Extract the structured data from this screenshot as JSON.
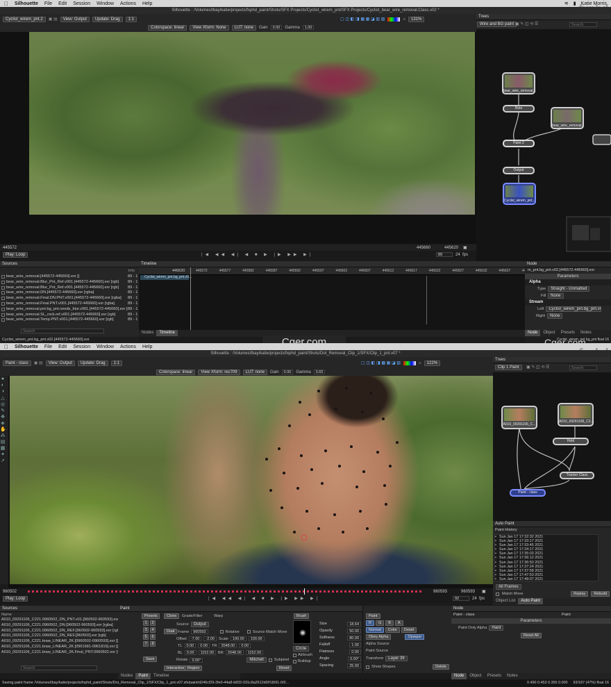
{
  "top": {
    "menubar": {
      "app": "Silhouette",
      "items": [
        "File",
        "Edit",
        "Session",
        "Window",
        "Actions",
        "Help"
      ],
      "window_title": "Silhouette : /Volumes/tbay/katie/projects/fxphd_paint/Shots/SFX Projects/Cyclist_wirem_pnt/SFX Projects/Cyclist_bear_wire_removal.Class.v02 *",
      "user": "Katie Morris"
    },
    "watermark": "fxphd",
    "viewer_toolbar": {
      "node": "Cyclist_wirem_pnt.2",
      "view": "View: Output",
      "update": "Update: Drag",
      "ratio": "1:1",
      "zoom": "131%"
    },
    "viewer_toolbar2": {
      "colorspace": "Colorspace: linear",
      "xform": "View Xform: None",
      "lut": "LUT: none",
      "gain_label": "Gain",
      "gain": "0.00",
      "gamma_label": "Gamma",
      "gamma": "1.00"
    },
    "timebar": {
      "start": "445572",
      "end": "445660",
      "current": "445620",
      "play": "Play: Loop",
      "frame": "89",
      "fps": "24",
      "fps_label": "fps"
    },
    "trees": {
      "title": "Trees",
      "dropdown": "Wire and BG paint",
      "search": "Search",
      "nodes": {
        "n1": "bear_wire_removal...",
        "n2": "Roto",
        "n3": "bear_wire_removal...",
        "n4": "Paint 2",
        "n5": "Output",
        "n6": "Cyclist_wirem_pnt..."
      }
    },
    "sources": {
      "title": "Sources",
      "col_info": "Info",
      "search": "Search",
      "rows": [
        {
          "name": "bear_wire_removal.[445572-445660].exr []",
          "info": "89 - 1"
        },
        {
          "name": "bear_wire_removal.Blur_Pnt_Ref.v001.[445572-445660].exr [rgb]",
          "info": "89 - 1"
        },
        {
          "name": "bear_wire_removal.Blur_Pnt_Ref.v001.[445572-445660].exr [rgb]",
          "info": "89 - 1"
        },
        {
          "name": "bear_wire_removal.DN.[445572-445660].exr [rgba]",
          "info": "89 - 1"
        },
        {
          "name": "bear_wire_removal.Final.DN.PNT.v001.[445572-445660].exr [rgba]",
          "info": "89 - 1"
        },
        {
          "name": "bear_wire_removal.Final.PNT.v001.[445572-445660].exr [rgba]",
          "info": "89 - 1"
        },
        {
          "name": "bear_wire_removal.pnt.bg_pnt.needs_blur.v001.[445572-445660].exr [rgba]",
          "info": "89 - 1"
        },
        {
          "name": "bear_wire_removal.SL_rock.ref.v001.[445572-445660].exr [rgb]",
          "info": "89 - 1"
        },
        {
          "name": "bear_wire_removal.Temp.PNT.v001.[445572-445660].exr [rgb]",
          "info": "89 - 1"
        }
      ],
      "footer": "Cyclist_wirem_pnt.bg_pnt.v02.[445572-445660].exr"
    },
    "timeline": {
      "title": "Timeline",
      "current": "445620",
      "ticks": [
        "445572",
        "445577",
        "445582",
        "445587",
        "445592",
        "445597",
        "445602",
        "445607",
        "445612",
        "445617",
        "445622",
        "445627",
        "445632",
        "445637",
        "445642"
      ],
      "track": "Cyclist_wirem_pnt.bg_pnt.v0...",
      "tabs": [
        "Nodes",
        "Timeline"
      ]
    },
    "node_panel": {
      "title": "Node",
      "file": "m_pnt.bg_pnt.v02.[445572-445660].exr",
      "params": "Parameters",
      "alpha": "Alpha",
      "type_label": "Type",
      "type": "Straight - Unmatted",
      "fill_label": "Fill",
      "fill": "None",
      "stream": "Stream",
      "left_label": "Left",
      "left": "Cyclist_wirem_pnt.bg_pnt.v02.[...]",
      "right_label": "Right",
      "right": "None",
      "tabs": [
        "Node",
        "Object",
        "Presets",
        "Notes"
      ],
      "footer": "Cyclist_wirem_pnt bg_pnt float 16"
    }
  },
  "bottom": {
    "menubar": {
      "app": "Silhouette",
      "items": [
        "File",
        "Edit",
        "Session",
        "Window",
        "Actions",
        "Help"
      ],
      "window_title": "Silhouette : /Volumes/tbay/katie/projects/fxphd_paint/Shots/Dot_Removal_Clip_1/SFX/Clip_1_pnt.v07 *"
    },
    "watermark": "fxphd",
    "cger": "Cger.com",
    "viewer_toolbar": {
      "node": "Paint - class",
      "view": "View: Output",
      "update": "Update: Drag",
      "ratio": "1:1",
      "zoom": "122%"
    },
    "viewer_toolbar2": {
      "colorspace": "Colorspace: linear",
      "xform": "View Xform: rec709",
      "lut": "LUT: none",
      "gain_label": "Gain",
      "gain": "0.00",
      "gamma_label": "Gamma",
      "gamma": "0.65"
    },
    "timebar": {
      "start": "960502",
      "end": "960593",
      "current": "960593",
      "play": "Play: Loop",
      "frame": "92",
      "fps": "24",
      "fps_label": "fps"
    },
    "trees": {
      "title": "Trees",
      "dropdown": "Clip 1 Paint",
      "search": "Search",
      "nodes": {
        "n1": "A010_09291106_C...",
        "n2": "A010_09291106_C2...",
        "n3": "Hold",
        "n4": "Tracker Class",
        "n5": "Paint - class"
      }
    },
    "autopaint": {
      "title": "Auto Paint",
      "history": "Paint History",
      "items": [
        "Sun Jan 17 17:32:32 2021",
        "Sun Jan 17 17:33:17 2021",
        "Sun Jan 17 17:33:45 2021",
        "Sun Jan 17 17:34:17 2021",
        "Sun Jan 17 17:35:03 2021",
        "Sun Jan 17 17:36:12 2021",
        "Sun Jan 17 17:36:50 2021",
        "Sun Jan 17 17:37:24 2021",
        "Sun Jan 17 17:37:58 2021",
        "Sun Jan 17 17:47:53 2021",
        "Sun Jan 17 17:49:07 2021"
      ],
      "frames": "All Frames",
      "match_move": "Match Move",
      "replay": "Replay",
      "rebuild": "Rebuild",
      "tabs": [
        "Object List",
        "Auto Paint"
      ]
    },
    "sources": {
      "title": "Sources",
      "col_name": "Name",
      "search": "Search",
      "rows": [
        "A010_09291106_C221.0960502_DN_PNT.v01.[960502-960593].exr [rgba]",
        "A010_09291106_C221.0960502_DN.[960502-960593].exr [rgba]",
        "A010_09291106_C221.0960502_DN_REF.[960502-960593].exr [rgb]",
        "A010_09291106_C221.0960502_DN_REF.[960502].exr [rgb]",
        "A010_09291106_C221.braw_LINEAR_2K.[0960502-0960593].exr []",
        "A010_09291106_C221.braw_LINEAR_2K.[0961681-0961816].exr []",
        "A010_09291106_C221.braw_LINEAR_2K.Final_PNT.0960502.exr [960502-96"
      ],
      "tabs": [
        "Nodes",
        "Paint",
        "Timeline"
      ]
    },
    "paint": {
      "title": "Paint",
      "presets": "Presets",
      "clone": "Clone",
      "grade": "Grade/Filter",
      "warp": "Warp",
      "brush": "Brush",
      "dual": "Dual",
      "save": "Save",
      "source_label": "Source",
      "source": "Output",
      "frame_label": "Frame",
      "frame": "960593",
      "relative": "Relative",
      "source_match_move": "Source Match Move",
      "offset_label": "Offset",
      "offset_x": "-7.00",
      "offset_y": "-2.00",
      "scale_label": "Scale",
      "scale_x": "100.00",
      "scale_y": "100.00",
      "tl_label": "TL",
      "tl_x": "0.00",
      "tl_y": "0.00",
      "tr_label": "TR",
      "tr_x": "2048.00",
      "tr_y": "0.00",
      "bl_label": "BL",
      "bl_x": "0.00",
      "bl_y": "1152.00",
      "br_label": "BR",
      "br_x": "2048.00",
      "br_y": "1152.00",
      "rotate_label": "Rotate",
      "rotate": "0.00°",
      "filter": "Mitchell",
      "subpixel": "Subpixel",
      "interactive": "Interactive",
      "region": "Region",
      "reset": "Reset",
      "shape": "Circle",
      "airbrush": "Airbrush",
      "buildup": "Buildup",
      "size_label": "Size",
      "size": "18.64",
      "opacity_label": "Opacity",
      "opacity": "50.00",
      "softness_label": "Softness",
      "softness": "80.00",
      "falloff_label": "Falloff",
      "falloff": "1.00",
      "flatness_label": "Flatness",
      "flatness": "0.00",
      "angle_label": "Angle",
      "angle": "0.00°",
      "spacing_label": "Spacing",
      "spacing": "25.00"
    },
    "paint2": {
      "title": "Paint",
      "mode": "Normal",
      "color": "Color",
      "detail": "Detail",
      "obey_alpha": "Obey Alpha",
      "opaque": "Opaque",
      "alpha_source": "Alpha Source",
      "paint_source": "Paint Source",
      "transform_label": "Transform",
      "transform": "Layer 39",
      "show_shapes": "Show Shapes",
      "delete": "Delete",
      "channels": [
        "R",
        "G",
        "B",
        "A"
      ]
    },
    "node_panel": {
      "title": "Node",
      "name": "Paint - class",
      "type": "Paint",
      "params": "Parameters",
      "paint_only_alpha": "Paint Only Alpha",
      "alpha_value": "Hard",
      "reset_all": "Reset All",
      "tabs": [
        "Node",
        "Object",
        "Presets",
        "Notes"
      ]
    },
    "status": {
      "left": "Saving paint frame /Volumes/tbay/katie/projects/fxphd_paint/Shots/Dot_Removal_Clip_1/SFX/Clip_1_pnt.v07.sfx/paint/d246cf29-2fe0-44a8-b832-031c8a2612d0/f18/91-0/0...",
      "right": "0.490 0.453 0.355 0.000",
      "right2": "93/187 (47%) float 16"
    }
  }
}
